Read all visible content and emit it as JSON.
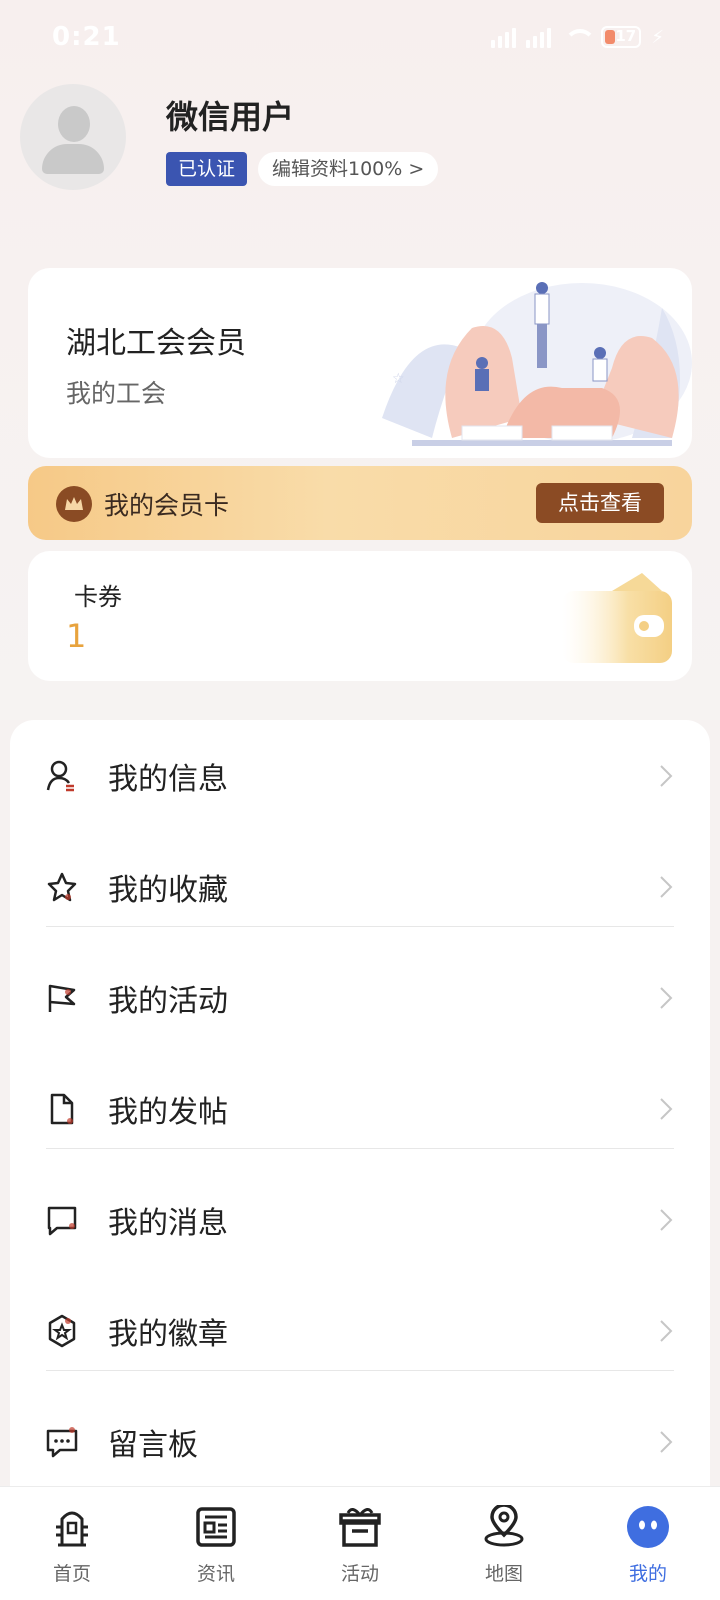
{
  "status_bar": {
    "time": "0:21",
    "battery": "17"
  },
  "profile": {
    "username": "微信用户",
    "verified_badge": "已认证",
    "edit_profile": "编辑资料100%  >"
  },
  "union_card": {
    "title": "湖北工会会员",
    "subtitle": "我的工会"
  },
  "member_card": {
    "label": "我的会员卡",
    "button": "点击查看"
  },
  "coupon": {
    "label": "卡券",
    "count": "1"
  },
  "menu": {
    "items": [
      {
        "label": "我的信息",
        "icon": "user-icon"
      },
      {
        "label": "我的收藏",
        "icon": "star-icon"
      },
      {
        "label": "我的活动",
        "icon": "flag-icon"
      },
      {
        "label": "我的发帖",
        "icon": "document-icon"
      },
      {
        "label": "我的消息",
        "icon": "message-icon"
      },
      {
        "label": "我的徽章",
        "icon": "badge-icon"
      },
      {
        "label": "留言板",
        "icon": "comment-board-icon"
      }
    ]
  },
  "tabs": [
    {
      "label": "首页",
      "icon": "home-tower-icon"
    },
    {
      "label": "资讯",
      "icon": "news-icon"
    },
    {
      "label": "活动",
      "icon": "gift-icon"
    },
    {
      "label": "地图",
      "icon": "map-pin-icon"
    },
    {
      "label": "我的",
      "icon": "profile-face-icon",
      "active": true
    }
  ],
  "colors": {
    "accent": "#3f6ee0",
    "verified": "#3b55b1",
    "member_brown": "#8b4b24",
    "coupon_count": "#e8a33d"
  }
}
